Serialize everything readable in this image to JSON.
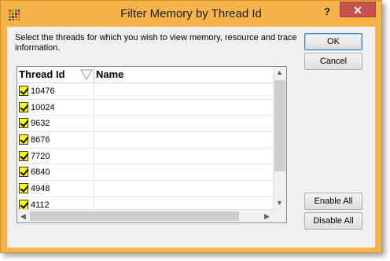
{
  "window": {
    "title": "Filter Memory by Thread Id",
    "help": "?",
    "close": "✕"
  },
  "instructions": "Select the threads for which you wish to view memory, resource and trace information.",
  "buttons": {
    "ok": "OK",
    "cancel": "Cancel",
    "enable_all": "Enable All",
    "disable_all": "Disable All"
  },
  "grid": {
    "columns": [
      "Thread Id",
      "Name"
    ],
    "rows": [
      {
        "id": "10476",
        "name": "",
        "checked": true
      },
      {
        "id": "10024",
        "name": "",
        "checked": true
      },
      {
        "id": "9632",
        "name": "",
        "checked": true
      },
      {
        "id": "8676",
        "name": "",
        "checked": true
      },
      {
        "id": "7720",
        "name": "",
        "checked": true
      },
      {
        "id": "6840",
        "name": "",
        "checked": true
      },
      {
        "id": "4948",
        "name": "",
        "checked": true
      },
      {
        "id": "4112",
        "name": "",
        "checked": true
      }
    ]
  },
  "colors": {
    "frame": "#f6b44a",
    "close": "#c75050",
    "checkbox": "#ffff00"
  }
}
